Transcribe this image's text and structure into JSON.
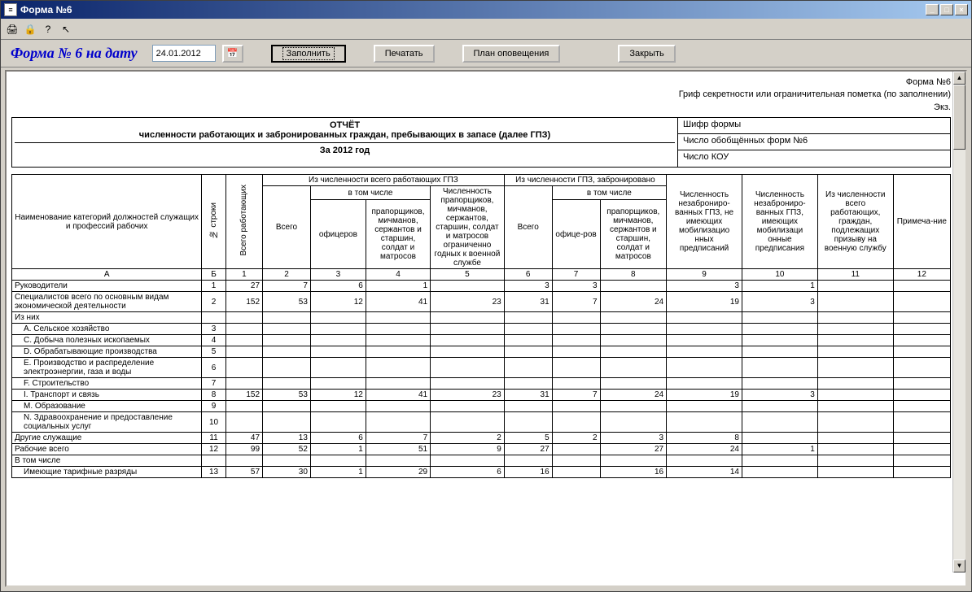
{
  "window": {
    "title": "Форма №6",
    "app_icon": "≡"
  },
  "win_buttons": {
    "min": "_",
    "max": "□",
    "close": "×"
  },
  "toolbar_icons": [
    "🖨",
    "🔒",
    "?",
    "↖"
  ],
  "controls": {
    "form_title": "Форма № 6 на дату",
    "date": "24.01.2012",
    "fill": "Заполнить",
    "print": "Печатать",
    "plan": "План оповещения",
    "close": "Закрыть"
  },
  "top_info": {
    "line1": "Форма №6",
    "line2": "Гриф секретности или ограничительная пометка (по заполнении)",
    "line3": "Экз."
  },
  "report_header": {
    "title1": "ОТЧЁТ",
    "title2": "численности работающих и забронированных граждан, пребывающих в запасе (далее ГПЗ)",
    "title3": "За 2012 год",
    "right1": "Шифр формы",
    "right2": "Число обобщённых форм №6",
    "right3": "Число КОУ"
  },
  "cols": {
    "name": "Наименование категорий должностей служащих и профессий рабочих",
    "line_no": "№ строки",
    "total_working": "Всего работающих",
    "gpz_header": "Из численности всего работающих ГПЗ",
    "booked_header": "Из численности ГПЗ, забронировано",
    "incl": "в том числе",
    "vsego": "Всего",
    "officers": "офицеров",
    "prapor": "прапорщиков, мичманов, сержантов и старшин, солдат и матросов",
    "prapor_limited": "Численность прапорщиков, мичманов, сержантов, старшин, солдат и матросов ограниченно годных к военной службе",
    "officers2": "офице-ров",
    "unbooked_no": "Численность незаброниро-ванных ГПЗ, не имеющих мобилизацио нных предписаний",
    "unbooked_yes": "Численность незаброниро-ванных ГПЗ, имеющих мобилизаци онные предписания",
    "draft": "Из численности всего работающих, граждан, подлежащих призыву на военную службу",
    "note": "Примеча-ние"
  },
  "col_letters": [
    "А",
    "Б",
    "1",
    "2",
    "3",
    "4",
    "5",
    "6",
    "7",
    "8",
    "9",
    "10",
    "11",
    "12"
  ],
  "rows": [
    {
      "name": "Руководители",
      "idx": "1",
      "c": [
        "27",
        "7",
        "6",
        "1",
        "",
        "3",
        "3",
        "",
        "3",
        "1",
        "",
        ""
      ]
    },
    {
      "name": "Специалистов всего по основным видам экономической деятельности",
      "idx": "2",
      "c": [
        "152",
        "53",
        "12",
        "41",
        "23",
        "31",
        "7",
        "24",
        "19",
        "3",
        "",
        ""
      ]
    },
    {
      "name": "Из них",
      "idx": "",
      "c": [
        "",
        "",
        "",
        "",
        "",
        "",
        "",
        "",
        "",
        "",
        "",
        ""
      ],
      "section": true
    },
    {
      "name": "A. Сельское хозяйство",
      "idx": "3",
      "c": [
        "",
        "",
        "",
        "",
        "",
        "",
        "",
        "",
        "",
        "",
        "",
        ""
      ],
      "indent": 1
    },
    {
      "name": "C. Добыча полезных ископаемых",
      "idx": "4",
      "c": [
        "",
        "",
        "",
        "",
        "",
        "",
        "",
        "",
        "",
        "",
        "",
        ""
      ],
      "indent": 1
    },
    {
      "name": "D. Обрабатывающие производства",
      "idx": "5",
      "c": [
        "",
        "",
        "",
        "",
        "",
        "",
        "",
        "",
        "",
        "",
        "",
        ""
      ],
      "indent": 1
    },
    {
      "name": "E. Производство и распределение электроэнергии, газа и воды",
      "idx": "6",
      "c": [
        "",
        "",
        "",
        "",
        "",
        "",
        "",
        "",
        "",
        "",
        "",
        ""
      ],
      "indent": 1
    },
    {
      "name": "F. Строительство",
      "idx": "7",
      "c": [
        "",
        "",
        "",
        "",
        "",
        "",
        "",
        "",
        "",
        "",
        "",
        ""
      ],
      "indent": 1
    },
    {
      "name": "I. Транспорт и связь",
      "idx": "8",
      "c": [
        "152",
        "53",
        "12",
        "41",
        "23",
        "31",
        "7",
        "24",
        "19",
        "3",
        "",
        ""
      ],
      "indent": 1
    },
    {
      "name": "M. Образование",
      "idx": "9",
      "c": [
        "",
        "",
        "",
        "",
        "",
        "",
        "",
        "",
        "",
        "",
        "",
        ""
      ],
      "indent": 1
    },
    {
      "name": "N. Здравоохранение и предоставление социальных услуг",
      "idx": "10",
      "c": [
        "",
        "",
        "",
        "",
        "",
        "",
        "",
        "",
        "",
        "",
        "",
        ""
      ],
      "indent": 1
    },
    {
      "name": "Другие служащие",
      "idx": "11",
      "c": [
        "47",
        "13",
        "6",
        "7",
        "2",
        "5",
        "2",
        "3",
        "8",
        "",
        "",
        ""
      ]
    },
    {
      "name": "Рабочие всего",
      "idx": "12",
      "c": [
        "99",
        "52",
        "1",
        "51",
        "9",
        "27",
        "",
        "27",
        "24",
        "1",
        "",
        ""
      ]
    },
    {
      "name": "В том числе",
      "idx": "",
      "c": [
        "",
        "",
        "",
        "",
        "",
        "",
        "",
        "",
        "",
        "",
        "",
        ""
      ],
      "section": true
    },
    {
      "name": "Имеющие тарифные разряды",
      "idx": "13",
      "c": [
        "57",
        "30",
        "1",
        "29",
        "6",
        "16",
        "",
        "16",
        "14",
        "",
        "",
        ""
      ],
      "indent": 1
    }
  ]
}
